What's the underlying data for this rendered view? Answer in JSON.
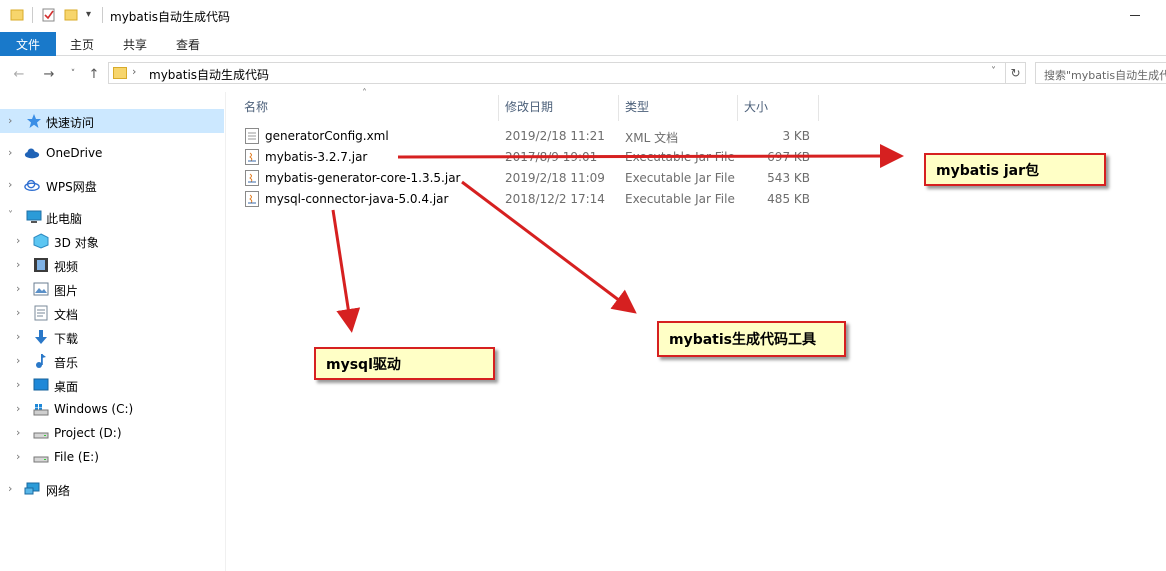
{
  "window": {
    "title": "mybatis自动生成代码"
  },
  "ribbon": {
    "file": "文件",
    "home": "主页",
    "share": "共享",
    "view": "查看"
  },
  "address": {
    "path": "mybatis自动生成代码",
    "search_placeholder": "搜索\"mybatis自动生成代码\""
  },
  "nav": {
    "quick_access": "快速访问",
    "onedrive": "OneDrive",
    "wps": "WPS网盘",
    "this_pc": "此电脑",
    "objects3d": "3D 对象",
    "videos": "视频",
    "pictures": "图片",
    "documents": "文档",
    "downloads": "下载",
    "music": "音乐",
    "desktop": "桌面",
    "drive_c": "Windows (C:)",
    "drive_d": "Project (D:)",
    "drive_e": "File (E:)",
    "network": "网络"
  },
  "columns": {
    "name": "名称",
    "modified": "修改日期",
    "type": "类型",
    "size": "大小"
  },
  "files": [
    {
      "name": "generatorConfig.xml",
      "modified": "2019/2/18 11:21",
      "type": "XML 文档",
      "size": "3 KB"
    },
    {
      "name": "mybatis-3.2.7.jar",
      "modified": "2017/8/9 19:01",
      "type": "Executable Jar File",
      "size": "697 KB"
    },
    {
      "name": "mybatis-generator-core-1.3.5.jar",
      "modified": "2019/2/18 11:09",
      "type": "Executable Jar File",
      "size": "543 KB"
    },
    {
      "name": "mysql-connector-java-5.0.4.jar",
      "modified": "2018/12/2 17:14",
      "type": "Executable Jar File",
      "size": "485 KB"
    }
  ],
  "annotations": {
    "jar": "mybatis jar包",
    "generator": "mybatis生成代码工具",
    "driver": "mysql驱动"
  },
  "colors": {
    "accent": "#1979ca",
    "selection": "#cce8ff",
    "arrow": "#d62020",
    "callout_bg": "#ffffc6"
  }
}
